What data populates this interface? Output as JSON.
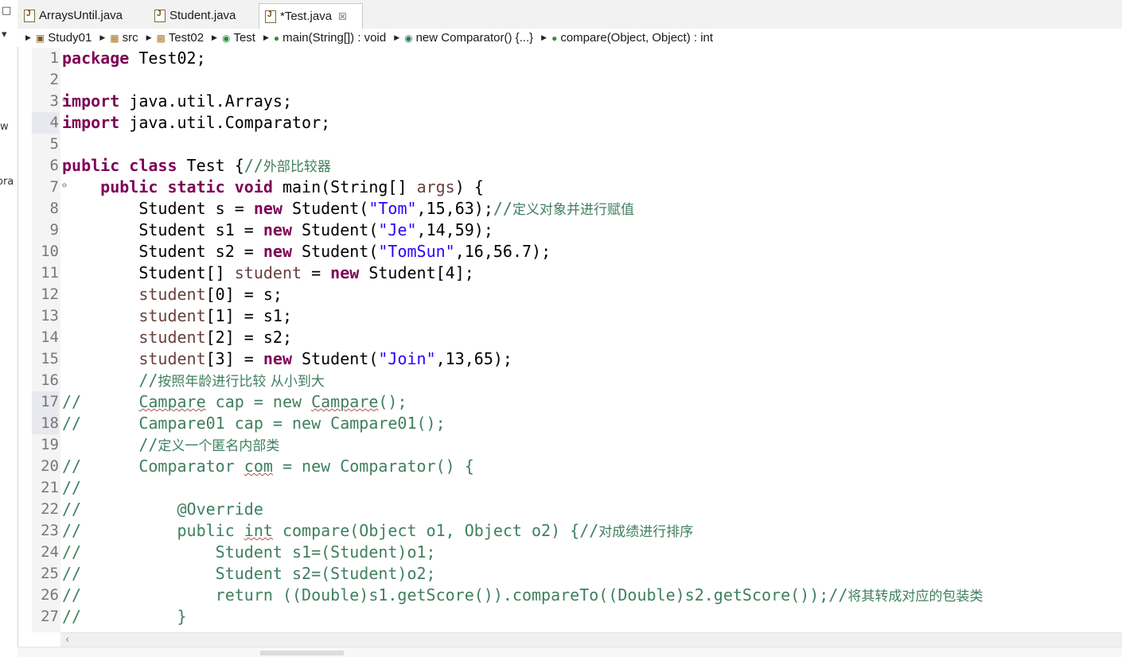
{
  "left_panel": {
    "clip_texts": [
      "w",
      "ora"
    ]
  },
  "tabs": [
    {
      "label": "ArraysUntil.java",
      "active": false,
      "icon": "java-file-icon"
    },
    {
      "label": "Student.java",
      "active": false,
      "icon": "java-file-icon"
    },
    {
      "label": "*Test.java",
      "active": true,
      "icon": "java-file-icon",
      "close": "☒"
    }
  ],
  "breadcrumb": [
    {
      "label": "Study01",
      "icon": "project-icon"
    },
    {
      "label": "src",
      "icon": "package-folder-icon"
    },
    {
      "label": "Test02",
      "icon": "package-icon"
    },
    {
      "label": "Test",
      "icon": "class-icon"
    },
    {
      "label": "main(String[]) : void",
      "icon": "method-icon"
    },
    {
      "label": "new Comparator() {...}",
      "icon": "anonymous-class-icon"
    },
    {
      "label": "compare(Object, Object) : int",
      "icon": "method-icon"
    }
  ],
  "editor": {
    "line_numbers": [
      "1",
      "2",
      "3",
      "4",
      "5",
      "6",
      "7",
      "8",
      "9",
      "10",
      "11",
      "12",
      "13",
      "14",
      "15",
      "16",
      "17",
      "18",
      "19",
      "20",
      "21",
      "22",
      "23",
      "24",
      "25",
      "26",
      "27"
    ],
    "lines": [
      "package Test02;",
      "",
      "import java.util.Arrays;",
      "import java.util.Comparator;",
      "",
      "public class Test {//外部比较器",
      "    public static void main(String[] args) {",
      "        Student s = new Student(\"Tom\",15,63);//定义对象并进行赋值",
      "        Student s1 = new Student(\"Je\",14,59);",
      "        Student s2 = new Student(\"TomSun\",16,56.7);",
      "        Student[] student = new Student[4];",
      "        student[0] = s;",
      "        student[1] = s1;",
      "        student[2] = s2;",
      "        student[3] = new Student(\"Join\",13,65);",
      "        //按照年龄进行比较 从小到大",
      "//      Campare cap = new Campare();",
      "//      Campare01 cap = new Campare01();",
      "        //定义一个匿名内部类",
      "//      Comparator com = new Comparator() {",
      "//",
      "//          @Override",
      "//          public int compare(Object o1, Object o2) {//对成绩进行排序",
      "//              Student s1=(Student)o1;",
      "//              Student s2=(Student)o2;",
      "//              return ((Double)s1.getScore()).compareTo((Double)s2.getScore());//将其转成对应的包装类",
      "//          }"
    ]
  },
  "colors": {
    "keyword": "#7f0055",
    "string": "#2a00ff",
    "comment": "#3f7f5f",
    "local_var": "#6a3e3e"
  }
}
